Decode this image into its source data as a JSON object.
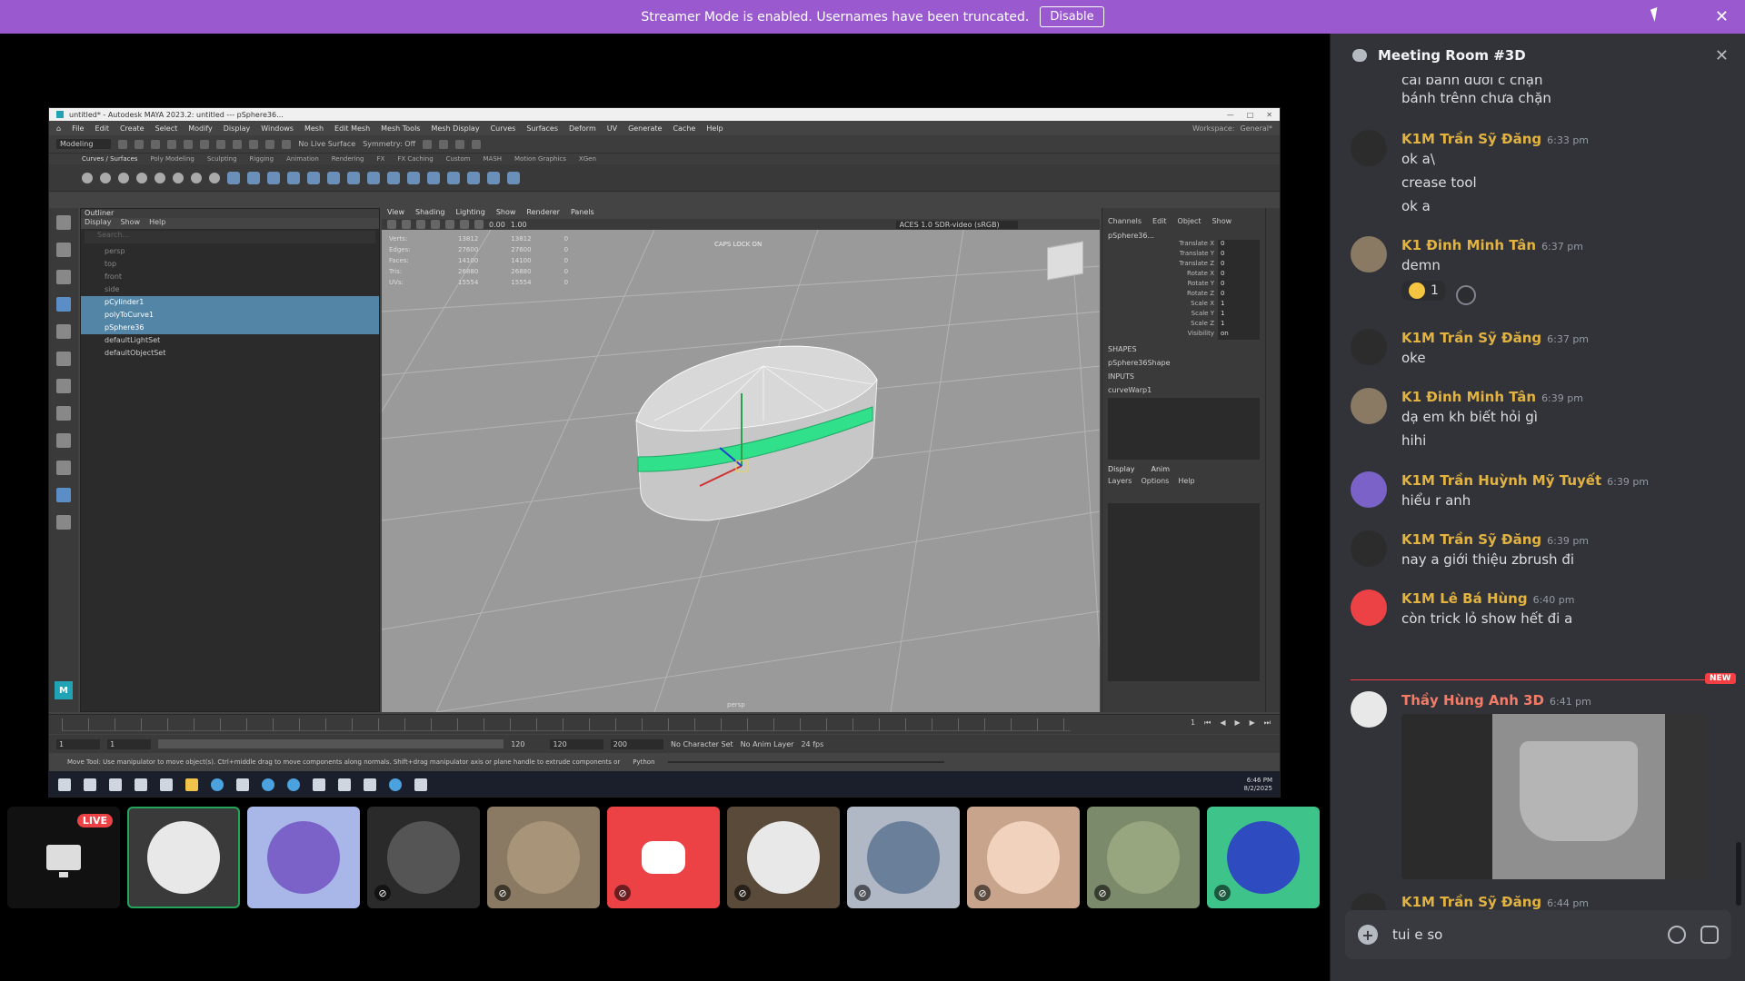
{
  "banner": {
    "text": "Streamer Mode is enabled. Usernames have been truncated.",
    "disable_label": "Disable",
    "color": "#9b59d0"
  },
  "maya": {
    "title": "untitled* - Autodesk MAYA 2023.2: untitled  ---  pSphere36...",
    "menus": [
      "File",
      "Edit",
      "Create",
      "Select",
      "Modify",
      "Display",
      "Windows",
      "Mesh",
      "Edit Mesh",
      "Mesh Tools",
      "Mesh Display",
      "Curves",
      "Surfaces",
      "Deform",
      "UV",
      "Generate",
      "Cache",
      "Help"
    ],
    "workspace_label": "Workspace:",
    "workspace_value": "General*",
    "mode": "Modeling",
    "live_surface": "No Live Surface",
    "symmetry": "Symmetry: Off",
    "shelf_tabs": [
      "Curves / Surfaces",
      "Poly Modeling",
      "Sculpting",
      "Rigging",
      "Animation",
      "Rendering",
      "FX",
      "FX Caching",
      "Custom",
      "MASH",
      "Motion Graphics",
      "XGen"
    ],
    "outliner": {
      "title": "Outliner",
      "menus": [
        "Display",
        "Show",
        "Help"
      ],
      "search_placeholder": "Search...",
      "rows": [
        {
          "label": "persp",
          "state": "dim"
        },
        {
          "label": "top",
          "state": "dim"
        },
        {
          "label": "front",
          "state": "dim"
        },
        {
          "label": "side",
          "state": "dim"
        },
        {
          "label": "pCylinder1",
          "state": "sel"
        },
        {
          "label": "polyToCurve1",
          "state": "sel"
        },
        {
          "label": "pSphere36",
          "state": "sel"
        },
        {
          "label": "defaultLightSet",
          "state": "node"
        },
        {
          "label": "defaultObjectSet",
          "state": "node"
        }
      ]
    },
    "viewport": {
      "menus": [
        "View",
        "Shading",
        "Lighting",
        "Show",
        "Renderer",
        "Panels"
      ],
      "exposure": "0.00",
      "gamma": "1.00",
      "colorspace": "ACES 1.0 SDR-video (sRGB)",
      "stats": [
        {
          "label": "Verts:",
          "a": "13812",
          "b": "13812",
          "c": "0"
        },
        {
          "label": "Edges:",
          "a": "27600",
          "b": "27600",
          "c": "0"
        },
        {
          "label": "Faces:",
          "a": "14100",
          "b": "14100",
          "c": "0"
        },
        {
          "label": "Tris:",
          "a": "26880",
          "b": "26880",
          "c": "0"
        },
        {
          "label": "UVs:",
          "a": "15554",
          "b": "15554",
          "c": "0"
        }
      ],
      "camera_note": "CAPS LOCK ON",
      "camera": "persp"
    },
    "channelbox": {
      "menus": [
        "Channels",
        "Edit",
        "Object",
        "Show"
      ],
      "object": "pSphere36...",
      "channels": [
        {
          "label": "Translate X",
          "value": "0"
        },
        {
          "label": "Translate Y",
          "value": "0"
        },
        {
          "label": "Translate Z",
          "value": "0"
        },
        {
          "label": "Rotate X",
          "value": "0"
        },
        {
          "label": "Rotate Y",
          "value": "0"
        },
        {
          "label": "Rotate Z",
          "value": "0"
        },
        {
          "label": "Scale X",
          "value": "1"
        },
        {
          "label": "Scale Y",
          "value": "1"
        },
        {
          "label": "Scale Z",
          "value": "1"
        },
        {
          "label": "Visibility",
          "value": "on"
        }
      ],
      "shapes_label": "SHAPES",
      "shape": "pSphere36Shape",
      "inputs_label": "INPUTS",
      "input": "curveWarp1",
      "display_tabs": [
        "Display",
        "Anim"
      ],
      "display_menus": [
        "Layers",
        "Options",
        "Help"
      ]
    },
    "range": {
      "start": "1",
      "start2": "1",
      "slider_end": "120",
      "end": "120",
      "end2": "200",
      "character_set": "No Character Set",
      "anim_layer": "No Anim Layer",
      "fps": "24 fps",
      "current_frame": "1"
    },
    "help_text": "Move Tool: Use manipulator to move object(s). Ctrl+middle drag to move components along normals. Shift+drag manipulator axis or plane handle to extrude components or",
    "python_label": "Python",
    "clock_time": "6:46 PM",
    "clock_date": "8/2/2025"
  },
  "participants": [
    {
      "name": "stream",
      "live_label": "LIVE"
    },
    {
      "name": "participant-1",
      "color": "#e8e8e8",
      "muted": false
    },
    {
      "name": "participant-2",
      "color": "#7a62c9",
      "muted": false
    },
    {
      "name": "participant-3",
      "color": "#2a2a2a",
      "muted": true
    },
    {
      "name": "participant-4",
      "color": "#8a7a63",
      "muted": true
    },
    {
      "name": "participant-5",
      "color": "#ed4245",
      "muted": true
    },
    {
      "name": "participant-6",
      "color": "#5a4a3a",
      "muted": true
    },
    {
      "name": "participant-7",
      "color": "#b0b7c5",
      "muted": true
    },
    {
      "name": "participant-8",
      "color": "#c9a48c",
      "muted": true
    },
    {
      "name": "participant-9",
      "color": "#7a8a6a",
      "muted": true
    },
    {
      "name": "participant-10",
      "color": "#3ec48b",
      "muted": true
    }
  ],
  "chat": {
    "title": "Meeting Room #3D",
    "top_lines": [
      "cái bánh dưới c chặn",
      "bánh trênn chưa chặn"
    ],
    "messages": [
      {
        "author": "K1M Trần Sỹ Đăng",
        "time": "6:33 pm",
        "lines": [
          "ok a\\",
          "crease tool",
          "ok a"
        ],
        "name_color": "#e3b341",
        "avatar": "#2c2c2c"
      },
      {
        "author": "K1 Đinh Minh Tân",
        "time": "6:37 pm",
        "lines": [
          "demn"
        ],
        "name_color": "#e3b341",
        "avatar": "#8a7a63",
        "reaction_count": "1"
      },
      {
        "author": "K1M Trần Sỹ Đăng",
        "time": "6:37 pm",
        "lines": [
          "oke"
        ],
        "name_color": "#e3b341",
        "avatar": "#2c2c2c"
      },
      {
        "author": "K1 Đinh Minh Tân",
        "time": "6:39 pm",
        "lines": [
          "dạ em kh biết hỏi gì",
          "hihi"
        ],
        "name_color": "#e3b341",
        "avatar": "#8a7a63"
      },
      {
        "author": "K1M Trần Huỳnh Mỹ Tuyết",
        "time": "6:39 pm",
        "lines": [
          "hiểu r anh"
        ],
        "name_color": "#e3b341",
        "avatar": "#7a62c9"
      },
      {
        "author": "K1M Trần Sỹ Đăng",
        "time": "6:39 pm",
        "lines": [
          "nay a giới thiệu zbrush đi"
        ],
        "name_color": "#e3b341",
        "avatar": "#2c2c2c"
      },
      {
        "author": "K1M Lê Bá Hùng",
        "time": "6:40 pm",
        "lines": [
          "còn trick lỏ show hết đi a"
        ],
        "name_color": "#e3b341",
        "avatar": "#ed4245"
      },
      {
        "author": "Thầy Hùng Anh 3D",
        "time": "6:41 pm",
        "lines": [],
        "name_color": "#f47b67",
        "avatar": "#e8e8e8"
      },
      {
        "author": "K1M Trần Sỹ Đăng",
        "time": "6:44 pm",
        "lines": [
          "=))"
        ],
        "name_color": "#e3b341",
        "avatar": "#2c2c2c"
      }
    ],
    "new_label": "NEW",
    "composer_value": "tui e so"
  }
}
